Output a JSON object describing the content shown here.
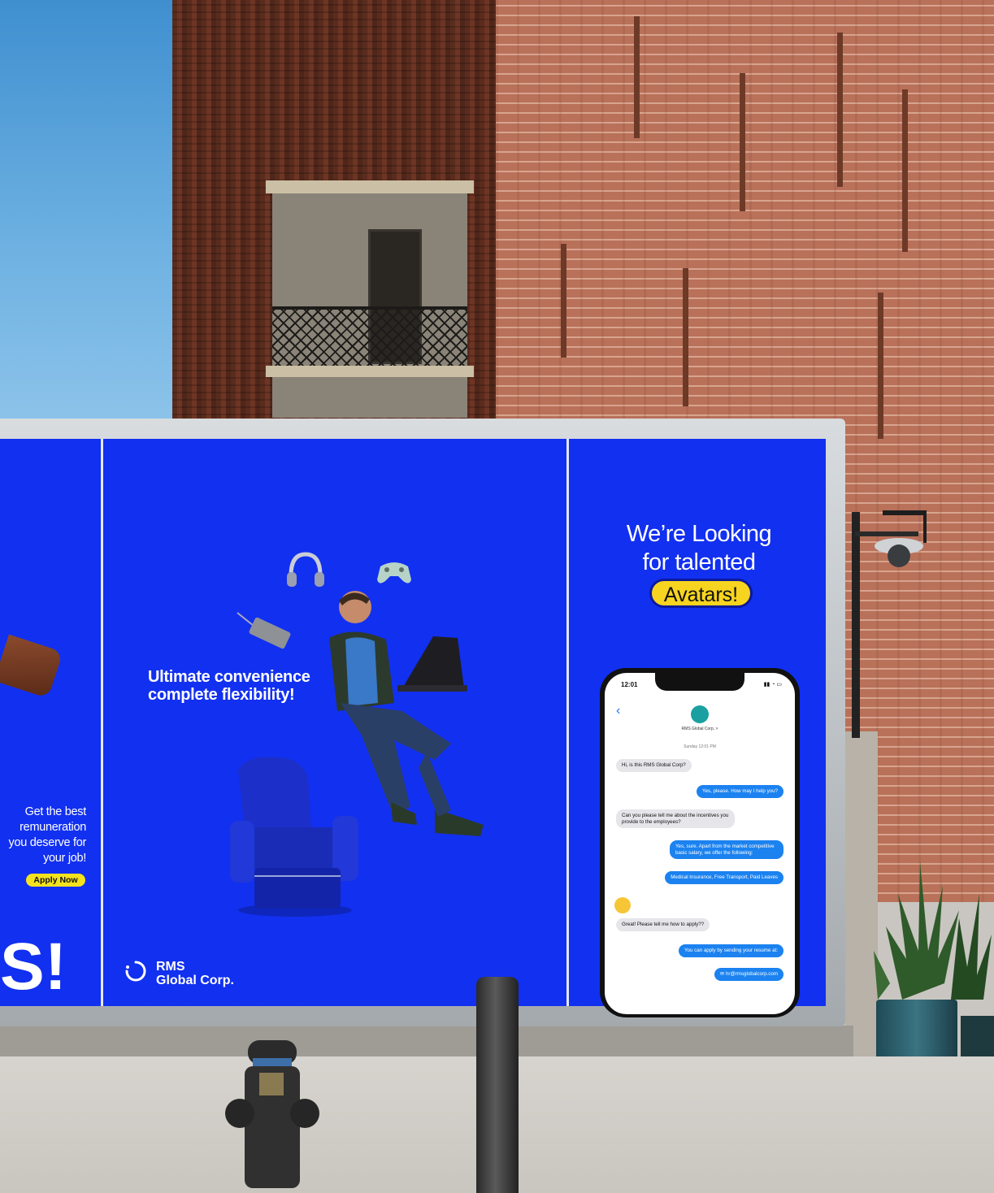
{
  "billboard": {
    "panel_left": {
      "tagline": "Get the best remuneration you deserve for your job!",
      "tagline_lines": [
        "Get the best",
        "remuneration",
        "you deserve for",
        "your job!"
      ],
      "apply_label": "Apply Now",
      "big_text": "S!"
    },
    "panel_center": {
      "headline_line1": "Ultimate convenience",
      "headline_line2": "complete flexibility!",
      "brand_line1": "RMS",
      "brand_line2": "Global Corp."
    },
    "panel_right": {
      "headline_line1": "We’re Looking",
      "headline_line2": "for talented",
      "highlight": "Avatars!",
      "phone": {
        "time": "12:01",
        "contact": "RMS Global Corp. >",
        "date": "Sunday 12:01 PM",
        "messages": [
          {
            "from": "user",
            "text": "Hi, is this RMS Global Corp?"
          },
          {
            "from": "company",
            "text": "Yes, please. How may I help you?"
          },
          {
            "from": "user",
            "text": "Can you please tell me about the incentives you provide to the employees?"
          },
          {
            "from": "company",
            "text": "Yes, sure. Apart from the market competitive basic salary, we offer the following:"
          },
          {
            "from": "company",
            "text": "Medical Insurance, Free Transport, Paid Leaves"
          },
          {
            "from": "user",
            "text": "Great! Please tell me how to apply??"
          },
          {
            "from": "company",
            "text": "You can apply by sending your resume at:"
          },
          {
            "from": "company",
            "text": "hr@rmsglobalcorp.com"
          }
        ]
      }
    }
  },
  "colors": {
    "billboard_blue": "#1230f0",
    "highlight_yellow": "#f7d41f",
    "bubble_blue": "#1b82f0"
  },
  "icons": [
    "headphones-icon",
    "game-controller-icon",
    "mobile-phone-icon",
    "laptop-icon",
    "armchair-icon",
    "email-icon",
    "back-chevron-icon"
  ]
}
